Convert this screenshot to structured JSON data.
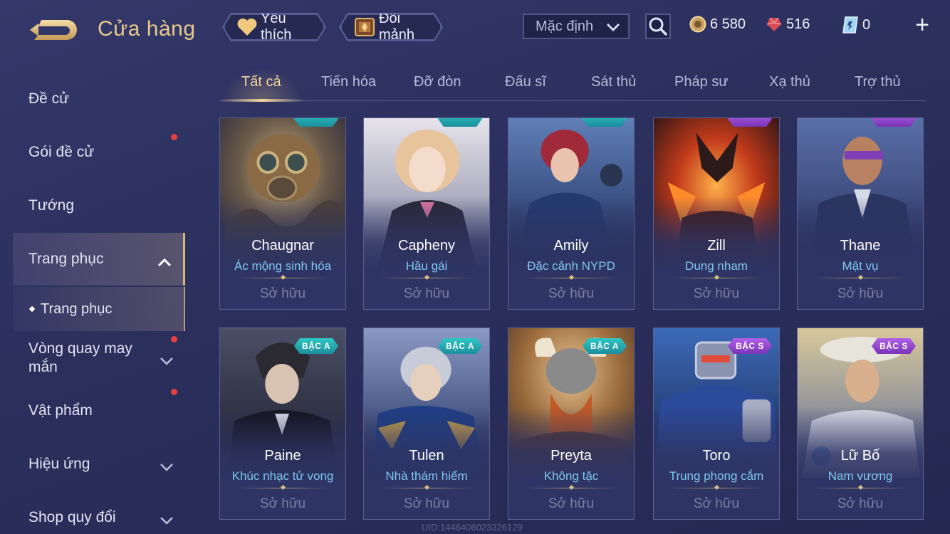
{
  "header": {
    "title": "Cửa hàng",
    "favorites_label": "Yêu thích",
    "fragments_label": "Đổi mảnh",
    "sort_value": "Mặc định",
    "currencies": [
      {
        "name": "gold-coin-icon",
        "value": "6 580"
      },
      {
        "name": "ruby-icon",
        "value": "516"
      },
      {
        "name": "voucher-icon",
        "value": "0"
      }
    ],
    "plus_label": "+"
  },
  "sidebar": {
    "items": [
      {
        "label": "Đề cử",
        "has_dot": false,
        "has_chevron": false
      },
      {
        "label": "Gói đề cử",
        "has_dot": true,
        "has_chevron": false
      },
      {
        "label": "Tướng",
        "has_dot": false,
        "has_chevron": false
      },
      {
        "label": "Trang phục",
        "has_dot": false,
        "has_chevron": "up",
        "active": true
      },
      {
        "label": "Trang phục",
        "sub": true
      },
      {
        "label": "Vòng quay may mắn",
        "has_dot": true,
        "has_chevron": "down"
      },
      {
        "label": "Vật phẩm",
        "has_dot": true,
        "has_chevron": false
      },
      {
        "label": "Hiệu ứng",
        "has_dot": false,
        "has_chevron": "down"
      },
      {
        "label": "Shop quy đổi",
        "has_dot": false,
        "has_chevron": "down"
      }
    ]
  },
  "tabs": [
    "Tất cả",
    "Tiến hóa",
    "Đỡ đòn",
    "Đấu sĩ",
    "Sát thủ",
    "Pháp sư",
    "Xạ thủ",
    "Trợ thủ"
  ],
  "active_tab": "Tất cả",
  "cards": [
    {
      "hero": "Chaugnar",
      "skin": "Ác mộng sinh hóa",
      "status": "Sở hữu",
      "badge_class": "a"
    },
    {
      "hero": "Capheny",
      "skin": "Hầu gái",
      "status": "Sở hữu",
      "badge_class": "a"
    },
    {
      "hero": "Amily",
      "skin": "Đặc cảnh NYPD",
      "status": "Sở hữu",
      "badge_class": "a"
    },
    {
      "hero": "Zill",
      "skin": "Dung nham",
      "status": "Sở hữu",
      "badge_class": "s"
    },
    {
      "hero": "Thane",
      "skin": "Mật vụ",
      "status": "Sở hữu",
      "badge_class": "s"
    },
    {
      "hero": "Paine",
      "skin": "Khúc nhạc tử vong",
      "status": "Sở hữu",
      "badge": "BẬC A",
      "badge_class": "a"
    },
    {
      "hero": "Tulen",
      "skin": "Nhà thám hiểm",
      "status": "Sở hữu",
      "badge": "BẬC A",
      "badge_class": "a"
    },
    {
      "hero": "Preyta",
      "skin": "Không tặc",
      "status": "Sở hữu",
      "badge": "BẬC A",
      "badge_class": "a"
    },
    {
      "hero": "Toro",
      "skin": "Trung phong cắm",
      "status": "Sở hữu",
      "badge": "BẬC S",
      "badge_class": "s"
    },
    {
      "hero": "Lữ Bố",
      "skin": "Nam vương",
      "status": "Sở hữu",
      "badge": "BẬC S",
      "badge_class": "s"
    }
  ],
  "watermark": "UID:1446406023326129",
  "colors": {
    "background": "#2b2f5c",
    "title_gold": "#e9c98b",
    "skin_blue": "#7ec6f2",
    "badge_a": "#2fc7c4",
    "badge_s": "#9a4ad6",
    "notification_red": "#e8403e"
  }
}
